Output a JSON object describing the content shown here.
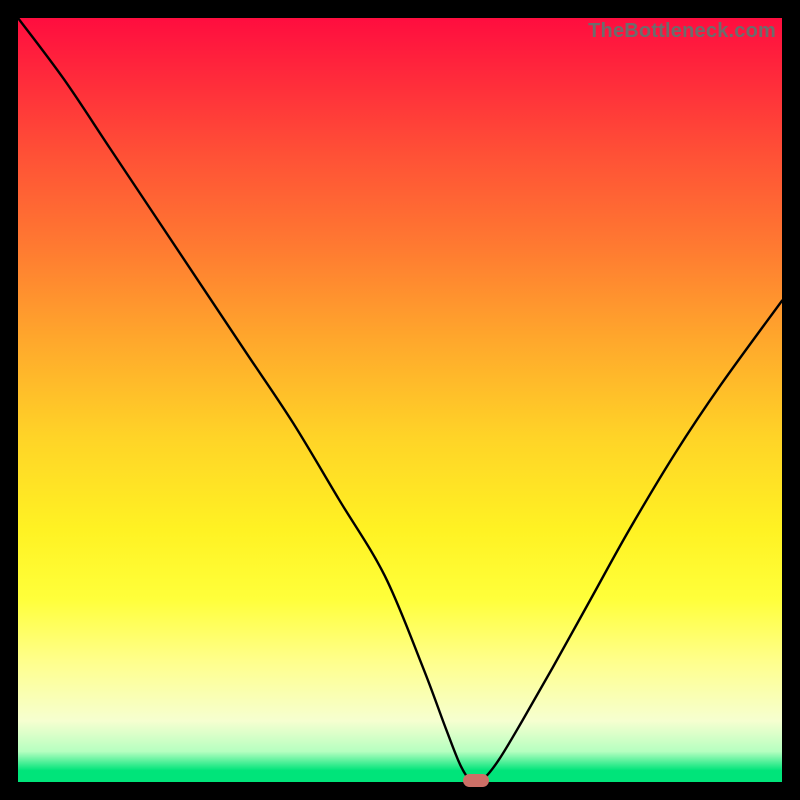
{
  "watermark": "TheBottleneck.com",
  "chart_data": {
    "type": "line",
    "title": "",
    "xlabel": "",
    "ylabel": "",
    "xlim": [
      0,
      100
    ],
    "ylim": [
      0,
      100
    ],
    "grid": false,
    "series": [
      {
        "name": "bottleneck-curve",
        "x": [
          0,
          6,
          12,
          18,
          24,
          30,
          36,
          42,
          48,
          53,
          56,
          58,
          59.5,
          61,
          63,
          66,
          70,
          75,
          80,
          86,
          92,
          100
        ],
        "values": [
          100,
          92,
          83,
          74,
          65,
          56,
          47,
          37,
          27,
          15,
          7,
          2,
          0,
          0.5,
          3,
          8,
          15,
          24,
          33,
          43,
          52,
          63
        ]
      }
    ],
    "annotations": {
      "min_marker": {
        "x": 60,
        "y": 0,
        "color": "#cc6f66"
      }
    },
    "gradient_stops": [
      {
        "pct": 0,
        "color": "#ff0d3f"
      },
      {
        "pct": 30,
        "color": "#ff7a31"
      },
      {
        "pct": 55,
        "color": "#ffd427"
      },
      {
        "pct": 76,
        "color": "#ffff3a"
      },
      {
        "pct": 96,
        "color": "#b6ffc0"
      },
      {
        "pct": 100,
        "color": "#00e47a"
      }
    ]
  }
}
